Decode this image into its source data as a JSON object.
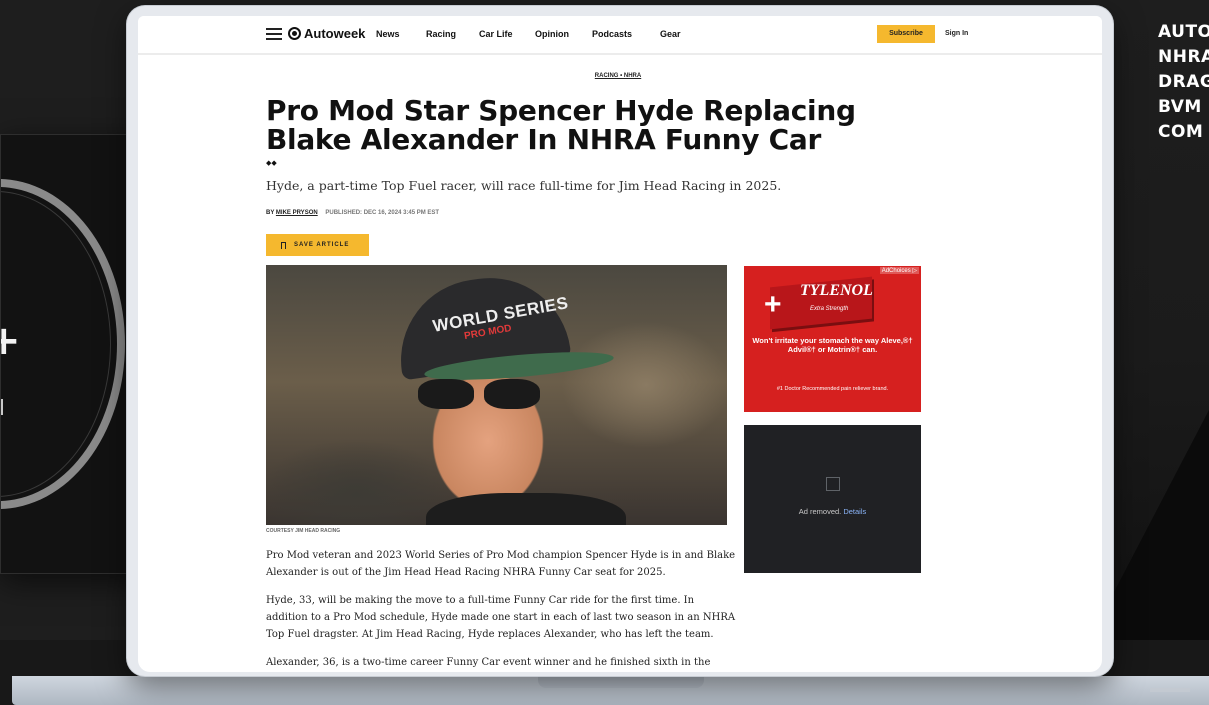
{
  "nav": {
    "logo": "Autoweek",
    "links": [
      "News",
      "Racing",
      "Car Life",
      "Opinion",
      "Podcasts",
      "Gear"
    ],
    "subscribe": "Subscribe",
    "sign_in": "Sign In"
  },
  "article": {
    "breadcrumb": "RACING • NHRA",
    "headline": "Pro Mod Star Spencer Hyde Replacing Blake Alexander In NHRA Funny Car",
    "diamonds": "◆◆",
    "subhead": "Hyde, a part-time Top Fuel racer, will race full-time for Jim Head Racing in 2025.",
    "by": "BY",
    "author": "MIKE PRYSON",
    "published": "PUBLISHED: DEC 16, 2024 3:45 PM EST",
    "save_label": "SAVE ARTICLE",
    "hero_hat_text": "WORLD SERIES",
    "hero_hat_sub": "PRO MOD",
    "caption": "COURTESY JIM HEAD RACING",
    "paragraphs": [
      "Pro Mod veteran and 2023 World Series of Pro Mod champion Spencer Hyde is in and Blake Alexander is out of the Jim Head Head Racing NHRA Funny Car seat for 2025.",
      "Hyde, 33, will be making the move to a full-time Funny Car ride for the first time. In addition to a Pro Mod schedule, Hyde made one start in each of last two season in an NHRA Top Fuel dragster. At Jim Head Racing, Hyde replaces Alexander, who has left the team.",
      "Alexander, 36, is a two-time career Funny Car event winner and he finished sixth in the"
    ]
  },
  "ads": {
    "ad1": {
      "adchoices": "AdChoices ▷",
      "brand": "TYLENOL",
      "subbrand": "Extra Strength",
      "tagline": "Won't irritate your stomach the way Aleve,®† Advil®† or Motrin®† can.",
      "recommend": "#1 Doctor Recommended pain reliever brand."
    },
    "ad2": {
      "removed_text": "Ad removed.",
      "details_link": "Details"
    }
  },
  "side_text": [
    "AUTO",
    "NHRA",
    "DRAG",
    "BVM",
    "COM"
  ],
  "colors": {
    "accent": "#f5b82e",
    "ad_red": "#d6201f",
    "background": "#1e1e1e"
  }
}
